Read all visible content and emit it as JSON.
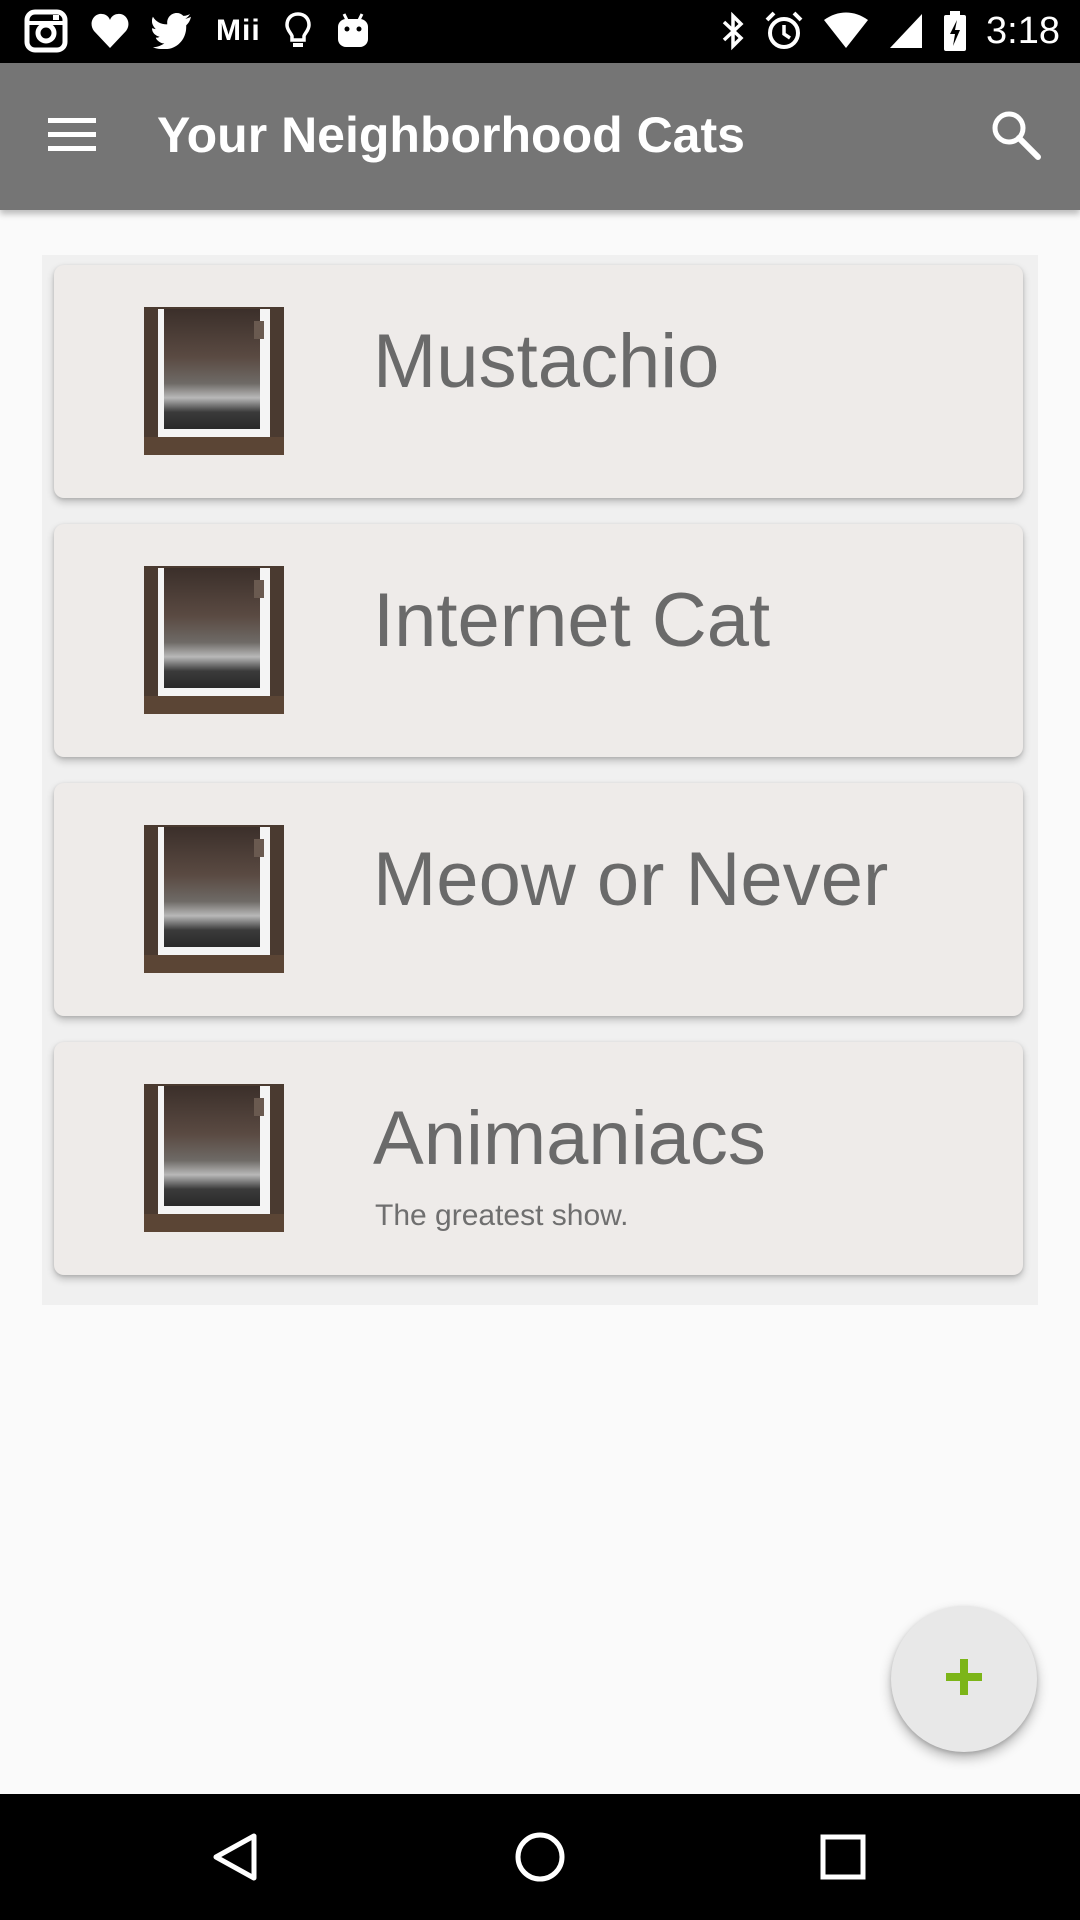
{
  "status_bar": {
    "left_icons": [
      "instagram-icon",
      "heart-icon",
      "twitter-icon",
      "mii-text",
      "lightbulb-icon",
      "android-icon"
    ],
    "mii_label": "Mii",
    "right_icons": [
      "bluetooth-icon",
      "alarm-icon",
      "wifi-icon",
      "signal-icon",
      "battery-icon"
    ],
    "clock": "3:18"
  },
  "app_bar": {
    "title": "Your Neighborhood Cats",
    "menu_icon": "hamburger-menu-icon",
    "search_icon": "search-icon"
  },
  "cats": [
    {
      "name": "Mustachio",
      "description": ""
    },
    {
      "name": "Internet Cat",
      "description": ""
    },
    {
      "name": "Meow or Never",
      "description": ""
    },
    {
      "name": "Animaniacs",
      "description": "The greatest show."
    }
  ],
  "fab": {
    "icon": "plus-icon",
    "color": "#7cb518"
  },
  "nav_bar": {
    "buttons": [
      "back-icon",
      "home-icon",
      "recents-icon"
    ]
  }
}
